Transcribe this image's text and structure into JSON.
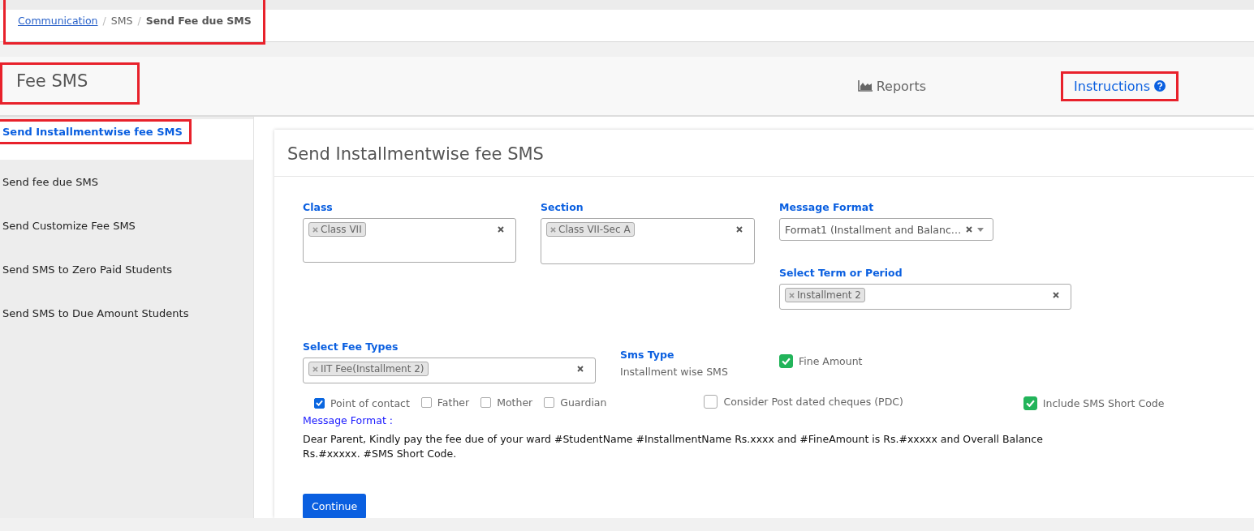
{
  "breadcrumb": {
    "highlighted": true,
    "items": [
      {
        "label": "Communication",
        "kind": "link"
      },
      {
        "label": "/",
        "kind": "separator"
      },
      {
        "label": "SMS",
        "kind": "plain"
      },
      {
        "label": "/",
        "kind": "separator"
      },
      {
        "label": "Send Fee due SMS",
        "kind": "current"
      }
    ]
  },
  "header": {
    "title": "Fee SMS",
    "title_highlighted": true,
    "links": [
      {
        "label": "Reports",
        "kind": "reports",
        "highlighted": false
      },
      {
        "label": "Instructions",
        "kind": "instructions",
        "highlighted": true
      }
    ]
  },
  "sidebar": {
    "items": [
      {
        "label": "Send Installmentwise fee SMS",
        "selected": true,
        "highlighted": true
      },
      {
        "label": "Send fee due SMS",
        "selected": false,
        "highlighted": false
      },
      {
        "label": "Send Customize Fee SMS",
        "selected": false,
        "highlighted": false
      },
      {
        "label": "Send SMS to Zero Paid Students",
        "selected": false,
        "highlighted": false
      },
      {
        "label": "Send SMS to Due Amount Students",
        "selected": false,
        "highlighted": false
      }
    ]
  },
  "card": {
    "title": "Send Installmentwise fee SMS",
    "class": {
      "label": "Class",
      "tags": [
        "Class VII"
      ]
    },
    "section": {
      "label": "Section",
      "tags": [
        "Class VII-Sec A"
      ]
    },
    "message_format": {
      "label": "Message Format",
      "value": "Format1 (Installment and Balanc…"
    },
    "term": {
      "label": "Select Term or Period",
      "tags": [
        "Installment 2"
      ]
    },
    "fee_types": {
      "label": "Select Fee Types",
      "tags": [
        "IIT Fee(Installment 2)"
      ]
    },
    "sms_type": {
      "label": "Sms Type",
      "value": "Installment wise SMS"
    },
    "fine_amount": {
      "label": "Fine Amount",
      "checked": true
    },
    "options": [
      {
        "label": "Point of contact",
        "checked": true,
        "kind": "small"
      },
      {
        "label": "Father",
        "checked": false,
        "kind": "small"
      },
      {
        "label": "Mother",
        "checked": false,
        "kind": "small"
      },
      {
        "label": "Guardian",
        "checked": false,
        "kind": "small"
      },
      {
        "label": "Consider Post dated cheques (PDC)",
        "checked": false,
        "kind": "large"
      },
      {
        "label": "Include SMS Short Code",
        "checked": true,
        "kind": "large"
      }
    ],
    "message": {
      "label": "Message Format :",
      "text": "Dear Parent, Kindly pay the fee due of your ward #StudentName #InstallmentName Rs.xxxx and #FineAmount is Rs.#xxxxx and Overall Balance Rs.#xxxxx. #SMS Short Code."
    },
    "continue_button": "Continue"
  }
}
